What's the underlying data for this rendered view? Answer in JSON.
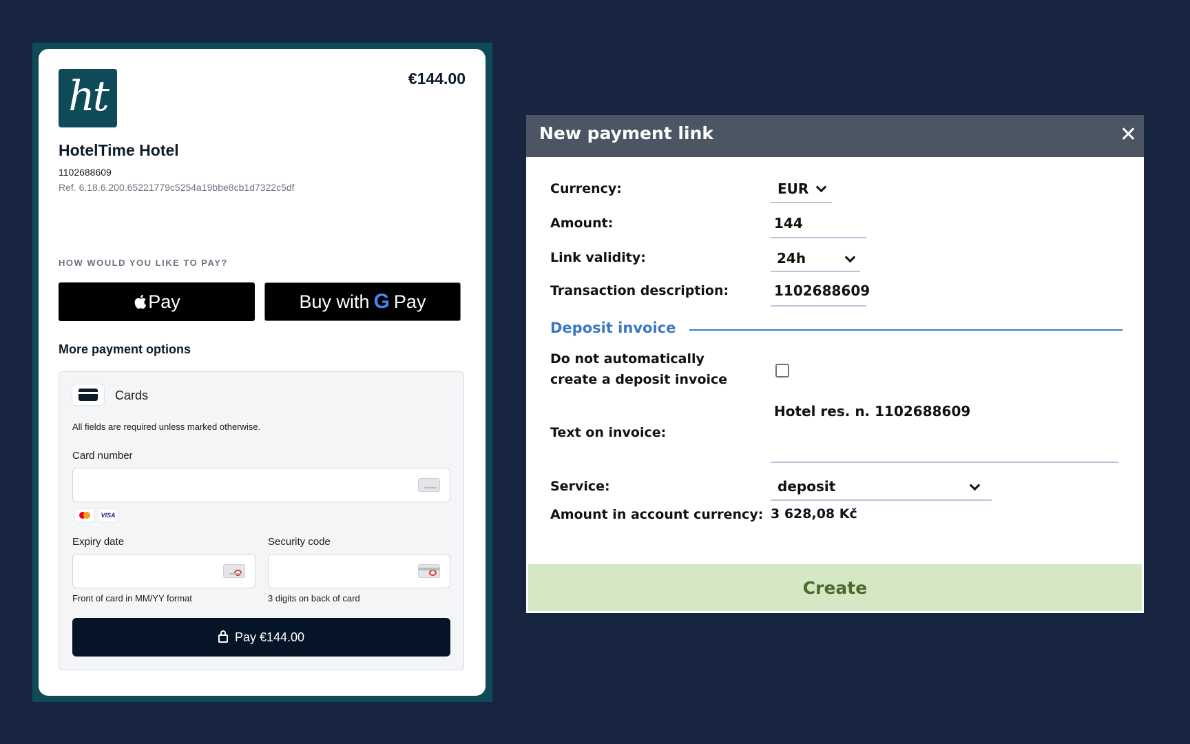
{
  "checkout": {
    "logo_text": "ht",
    "amount": "€144.00",
    "hotel_name": "HotelTime Hotel",
    "reservation_number": "1102688609",
    "reference": "Ref. 6.18.6.200.65221779c5254a19bbe8cb1d7322c5df",
    "pay_prompt": "HOW WOULD YOU LIKE TO PAY?",
    "apple_pay_label": "Pay",
    "google_pay_prefix": "Buy with",
    "google_pay_g": "G",
    "google_pay_suffix": "Pay",
    "more_options": "More payment options",
    "cards": {
      "tab_label": "Cards",
      "required_note": "All fields are required unless marked otherwise.",
      "card_number_label": "Card number",
      "brands": [
        "mastercard",
        "VISA"
      ],
      "expiry_label": "Expiry date",
      "expiry_hint": "Front of card in MM/YY format",
      "security_label": "Security code",
      "security_hint": "3 digits on back of card",
      "pay_button": "Pay €144.00"
    }
  },
  "modal": {
    "title": "New payment link",
    "close_icon": "close-icon",
    "fields": {
      "currency_label": "Currency:",
      "currency_value": "EUR",
      "amount_label": "Amount:",
      "amount_value": "144",
      "validity_label": "Link validity:",
      "validity_value": "24h",
      "description_label": "Transaction description:",
      "description_value": "1102688609"
    },
    "deposit_section": "Deposit invoice",
    "no_auto_invoice_line1": "Do not automatically",
    "no_auto_invoice_line2": "create a deposit invoice",
    "no_auto_invoice_checked": false,
    "text_on_invoice_label": "Text on invoice:",
    "text_on_invoice_value": "Hotel res. n. 1102688609",
    "service_label": "Service:",
    "service_value": "deposit",
    "account_currency_label": "Amount in account currency:",
    "account_currency_value": "3 628,08 Kč",
    "create_button": "Create"
  },
  "colors": {
    "page_bg": "#172540",
    "brand_teal": "#0f4a58",
    "modal_header": "#4b5563",
    "section_blue": "#3b78c4",
    "create_green": "#d5e8c5"
  }
}
